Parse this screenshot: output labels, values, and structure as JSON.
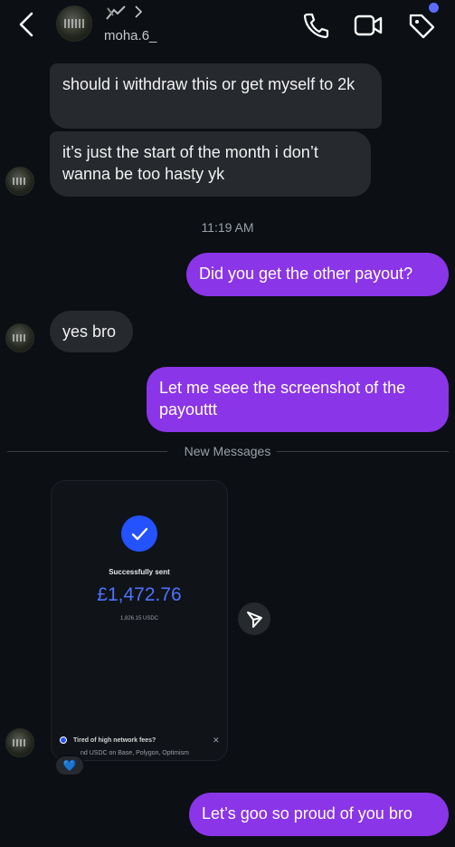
{
  "header": {
    "username": "moha.6_",
    "tag_dot_color": "#5b6cff"
  },
  "messages": [
    {
      "side": "in",
      "text": "should i withdraw this or get myself to 2k"
    },
    {
      "side": "in",
      "text": "it’s just the start of the month i don’t wanna be too hasty yk"
    },
    {
      "side": "out",
      "text": "Did you get the other payout?"
    },
    {
      "side": "in",
      "text": "yes bro"
    },
    {
      "side": "out",
      "text": "Let me seee the screenshot of the payouttt"
    },
    {
      "side": "out",
      "text": "Let’s goo so proud of you bro"
    }
  ],
  "timestamp": "11:19 AM",
  "divider_label": "New Messages",
  "shared_screenshot": {
    "status": "Successfully sent",
    "amount": "£1,472.76",
    "usdc": "1,826.15 USDC",
    "promo_title": "Tired of high network fees?",
    "promo_text": "nd USDC on Base, Polygon, Optimism",
    "promo_close": "✕"
  },
  "reaction": "💙",
  "colors": {
    "background": "#0c0f14",
    "incoming_bubble": "#26292e",
    "outgoing_bubble": "#8a35e8",
    "accent_blue": "#2452ff"
  },
  "icons": [
    "back-chevron-icon",
    "emoji-badge-icon",
    "chevron-right-icon",
    "phone-icon",
    "video-icon",
    "tag-icon",
    "check-icon",
    "share-icon",
    "blue-heart-icon"
  ]
}
